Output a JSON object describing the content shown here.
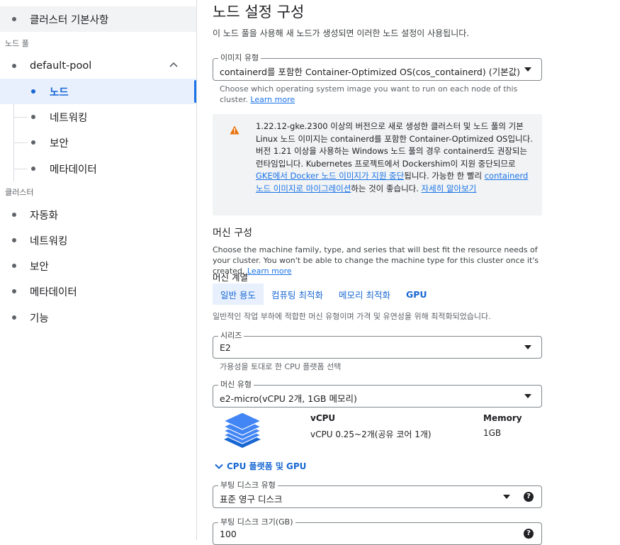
{
  "nav": {
    "top_item": "클러스터 기본사항",
    "node_pool_section": "노드 풀",
    "pool_name": "default-pool",
    "pool_children": [
      "노드",
      "네트워킹",
      "보안",
      "메타데이터"
    ],
    "cluster_section": "클러스터",
    "cluster_items": [
      "자동화",
      "네트워킹",
      "보안",
      "메타데이터",
      "기능"
    ]
  },
  "main": {
    "title": "노드 설정 구성",
    "description": "이 노드 풀을 사용해 새 노드가 생성되면 이러한 노드 설정이 사용됩니다.",
    "image_type": {
      "label": "이미지 유형",
      "value": "containerd를 포함한 Container-Optimized OS(cos_containerd) (기본값)",
      "hint_text": "Choose which operating system image you want to run on each node of this cluster.",
      "hint_link": "Learn more"
    },
    "warning": {
      "part1": "1.22.12-gke.2300 이상의 버전으로 새로 생성한 클러스터 및 노드 풀의 기본 Linux 노드 이미지는 containerd를 포함한 Container-Optimized OS입니다. 버전 1.21 이상을 사용하는 Windows 노드 풀의 경우 containerd도 권장되는 런타임입니다. Kubernetes 프로젝트에서 Dockershim이 지원 중단되므로 ",
      "link1": "GKE에서 Docker 노드 이미지가 지원 중단",
      "part2": "됩니다. 가능한 한 빨리 ",
      "link2": "containerd 노드 이미지로 마이그레이션",
      "part3": "하는 것이 좋습니다. ",
      "link3": "자세히 알아보기"
    },
    "machine_config": {
      "title": "머신 구성",
      "description": "Choose the machine family, type, and series that will best fit the resource needs of your cluster. You won't be able to change the machine type for this cluster once it's created.",
      "learn_more": "Learn more",
      "family_label": "머신 계열",
      "tabs": [
        "일반 용도",
        "컴퓨팅 최적화",
        "메모리 최적화",
        "GPU"
      ],
      "family_description": "일반적인 작업 부하에 적합한 머신 유형이며 가격 및 유연성을 위해 최적화되었습니다.",
      "series_label": "시리즈",
      "series_value": "E2",
      "series_hint": "가용성을 토대로 한 CPU 플랫폼 선택",
      "machine_type_label": "머신 유형",
      "machine_type_value": "e2-micro(vCPU 2개, 1GB 메모리)",
      "vcpu_header": "vCPU",
      "memory_header": "Memory",
      "vcpu_value": "vCPU 0.25~2개(공유 코어 1개)",
      "memory_value": "1GB",
      "expander": "CPU 플랫폼 및 GPU"
    },
    "boot_disk_type": {
      "label": "부팅 디스크 유형",
      "value": "표준 영구 디스크"
    },
    "boot_disk_size": {
      "label": "부팅 디스크 크기(GB)",
      "value": "100"
    },
    "help_glyph": "?"
  },
  "colors": {
    "accent": "#1a73e8",
    "active_bg": "#e8f0fe",
    "warning": "#e8710a",
    "stack_blue": "#4285f4"
  },
  "icons": [
    "chevron-up-icon",
    "warning-icon",
    "machine-stack-icon",
    "chevron-down-icon",
    "dropdown-caret-icon",
    "help-icon"
  ]
}
